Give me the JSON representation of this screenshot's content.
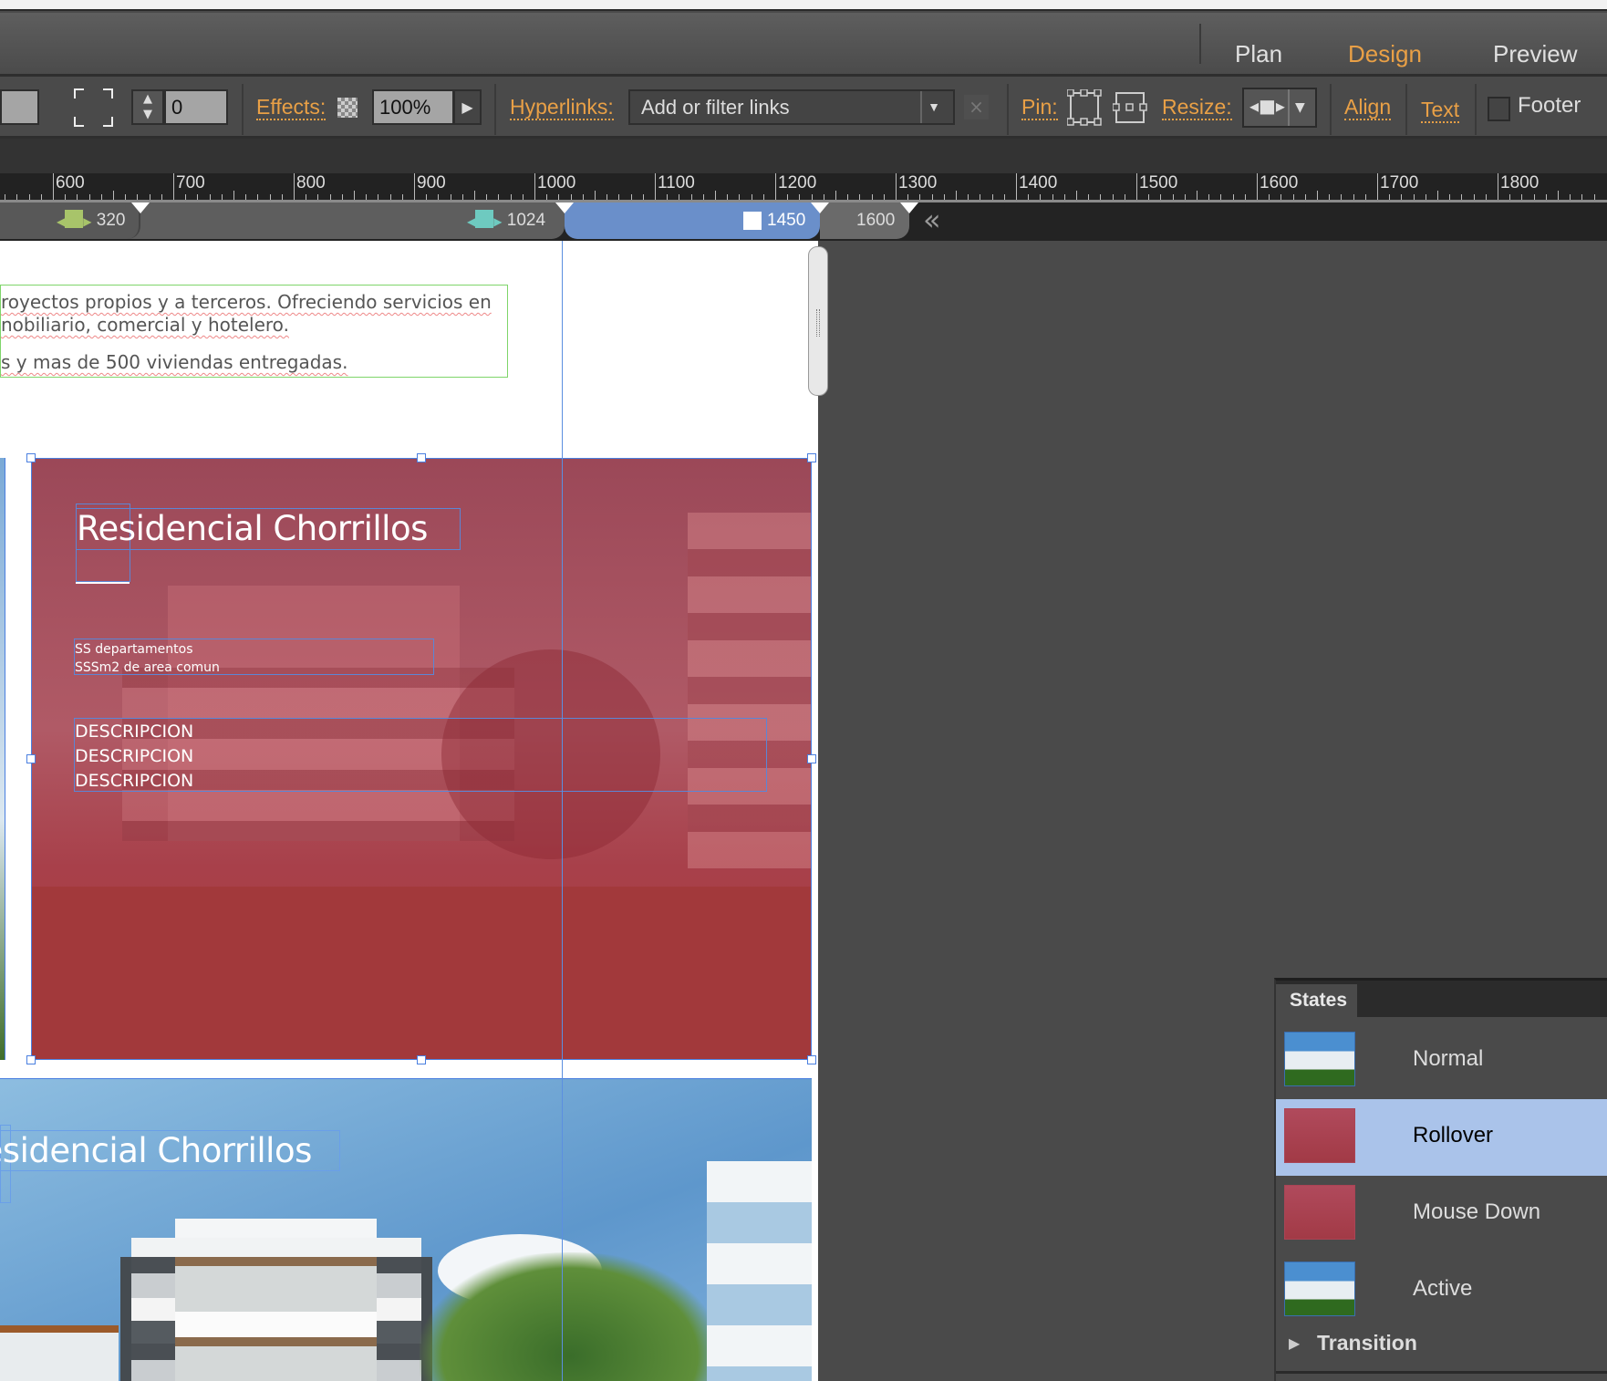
{
  "modes": {
    "plan": "Plan",
    "design": "Design",
    "preview": "Preview",
    "active": "Design"
  },
  "toolbar": {
    "stepper_value": "0",
    "effects_label": "Effects:",
    "opacity_value": "100%",
    "hyperlinks_label": "Hyperlinks:",
    "hyperlinks_placeholder": "Add or filter links",
    "pin_label": "Pin:",
    "resize_label": "Resize:",
    "align_label": "Align",
    "text_label": "Text",
    "footer_label": "Footer",
    "footer_checked": false
  },
  "ruler": {
    "labels": [
      "600",
      "700",
      "800",
      "900",
      "1000",
      "1100",
      "1200",
      "1300",
      "1400",
      "1500",
      "1600",
      "1700",
      "1800"
    ]
  },
  "breakpoints": {
    "items": [
      {
        "label": "320",
        "color": "#a8c46a"
      },
      {
        "label": "1024",
        "color": "#6ecac0"
      },
      {
        "label": "1450",
        "color": "#ffffff",
        "active": true
      },
      {
        "label": "1600"
      }
    ],
    "collapse_icon": "double-chevron-left-icon",
    "active_color": "#6a8fca"
  },
  "canvas": {
    "paragraph": [
      "royectos propios y a terceros. Ofreciendo servicios en",
      "nobiliario, comercial y hotelero.",
      "",
      "s y mas de 500 viviendas entregadas."
    ],
    "card_rollover": {
      "title": "Residencial Chorrillos",
      "details": [
        "SS departamentos",
        "SSSm2 de area comun"
      ],
      "descriptions": [
        "DESCRIPCION",
        "DESCRIPCION",
        "DESCRIPCION"
      ],
      "overlay_color": "#a8404f"
    },
    "card_normal": {
      "title": "Residencial Chorrillos"
    }
  },
  "states_panel": {
    "tab": "States",
    "items": [
      {
        "label": "Normal"
      },
      {
        "label": "Rollover",
        "selected": true
      },
      {
        "label": "Mouse Down"
      },
      {
        "label": "Active"
      }
    ],
    "transition_label": "Transition",
    "selected_color": "#aac3ea"
  }
}
